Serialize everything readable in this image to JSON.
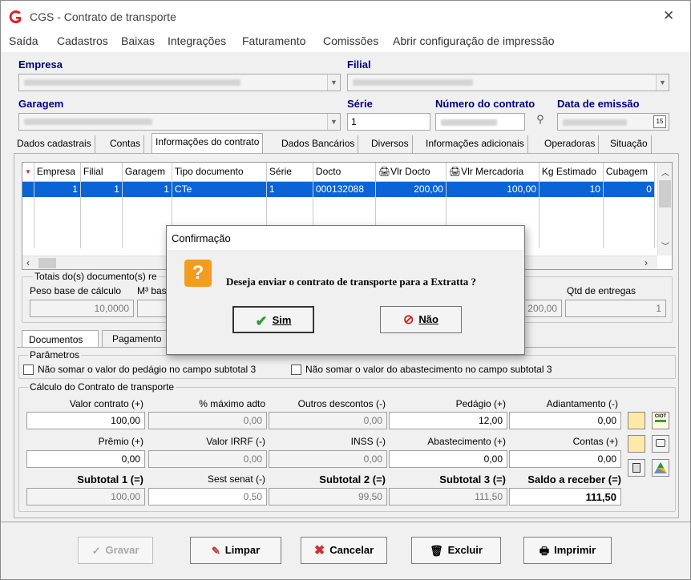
{
  "window": {
    "title": "CGS - Contrato de transporte",
    "close": "✕"
  },
  "menu": [
    "Saída",
    "Cadastros",
    "Baixas",
    "Integrações",
    "Faturamento",
    "Comissões",
    "Abrir configuração de impressão"
  ],
  "header": {
    "empresa_label": "Empresa",
    "filial_label": "Filial",
    "garagem_label": "Garagem",
    "serie_label": "Série",
    "serie_value": "1",
    "numero_label": "Número do contrato",
    "data_label": "Data de emissão"
  },
  "tabs": [
    "Dados cadastrais",
    "Contas",
    "Informações do contrato",
    "Dados Bancários",
    "Diversos",
    "Informações adicionais",
    "Operadoras",
    "Situação"
  ],
  "grid": {
    "columns": [
      "Empresa",
      "Filial",
      "Garagem",
      "Tipo documento",
      "Série",
      "Docto",
      "Vlr Docto",
      "Vlr Mercadoria",
      "Kg Estimado",
      "Cubagem"
    ],
    "rows": [
      [
        "1",
        "1",
        "1",
        "CTe",
        "1",
        "000132088",
        "200,00",
        "100,00",
        "10",
        "0"
      ]
    ]
  },
  "totais": {
    "title": "Totais do(s) documento(s) re",
    "peso_label": "Peso base de cálculo",
    "peso_value": "10,0000",
    "m3_label": "M³ bas",
    "vlr_value": "200,00",
    "entregas_label": "Qtd de entregas",
    "entregas_value": "1"
  },
  "subtabs": [
    "Documentos",
    "Pagamento"
  ],
  "parametros": {
    "title": "Parâmetros",
    "chk1": "Não somar o valor do pedágio no campo subtotal 3",
    "chk2": "Não somar o valor do abastecimento no campo subtotal 3"
  },
  "calculo": {
    "title": "Cálculo do Contrato de transporte",
    "row1": [
      {
        "label": "Valor contrato (+)",
        "value": "100,00"
      },
      {
        "label": "% máximo adto",
        "value": "0,00"
      },
      {
        "label": "Outros descontos (-)",
        "value": "0,00"
      },
      {
        "label": "Pedágio (+)",
        "value": "12,00"
      },
      {
        "label": "Adiantamento (-)",
        "value": "0,00"
      }
    ],
    "row2": [
      {
        "label": "Prêmio (+)",
        "value": "0,00"
      },
      {
        "label": "Valor IRRF (-)",
        "value": "0,00"
      },
      {
        "label": "INSS (-)",
        "value": "0,00"
      },
      {
        "label": "Abastecimento (+)",
        "value": "0,00"
      },
      {
        "label": "Contas (+)",
        "value": "0,00"
      }
    ],
    "row3": [
      {
        "label": "Subtotal 1 (=)",
        "value": "100,00"
      },
      {
        "label": "Sest senat (-)",
        "value": "0,50"
      },
      {
        "label": "Subtotal 2 (=)",
        "value": "99,50"
      },
      {
        "label": "Subtotal 3 (=)",
        "value": "111,50"
      },
      {
        "label": "Saldo a receber (=)",
        "value": "111,50"
      }
    ]
  },
  "buttons": {
    "gravar": "Gravar",
    "limpar": "Limpar",
    "cancelar": "Cancelar",
    "excluir": "Excluir",
    "imprimir": "Imprimir"
  },
  "dialog": {
    "title": "Confirmação",
    "message": "Deseja enviar o contrato de transporte para a Extratta ?",
    "yes": "Sim",
    "no": "Não"
  }
}
